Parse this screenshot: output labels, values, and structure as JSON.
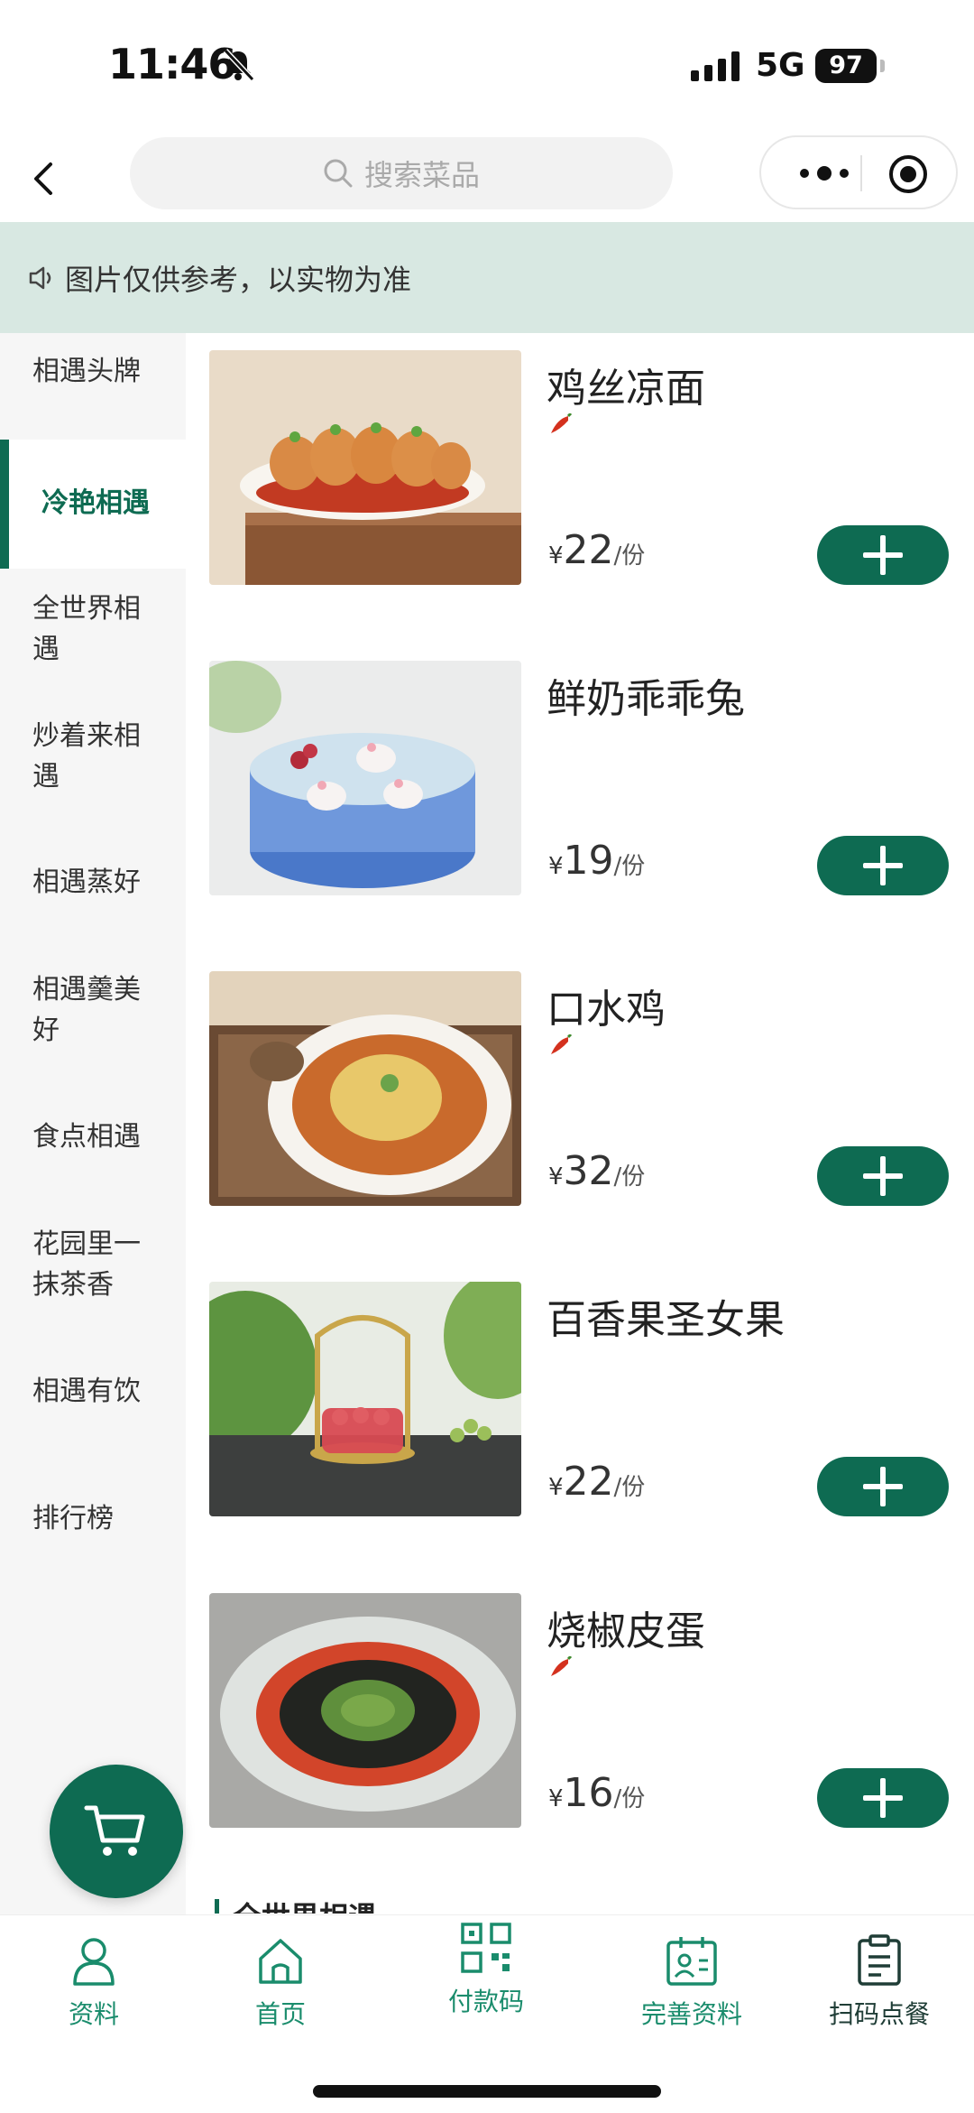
{
  "status_bar": {
    "time": "11:46",
    "network": "5G",
    "battery": "97"
  },
  "header": {
    "search_placeholder": "搜索菜品"
  },
  "notice": {
    "text": "图片仅供参考，以实物为准"
  },
  "sidebar": {
    "items": [
      {
        "label": "相遇头牌"
      },
      {
        "label": "冷艳相遇",
        "active": true
      },
      {
        "label": "全世界相遇"
      },
      {
        "label": "炒着来相遇"
      },
      {
        "label": "相遇蒸好"
      },
      {
        "label": "相遇羹美好"
      },
      {
        "label": "食点相遇"
      },
      {
        "label": "花园里一抹茶香"
      },
      {
        "label": "相遇有饮"
      },
      {
        "label": "排行榜"
      }
    ]
  },
  "dishes": [
    {
      "name": "鸡丝凉面",
      "currency": "¥",
      "price": "22",
      "unit": "/份",
      "spicy": true
    },
    {
      "name": "鲜奶乖乖兔",
      "currency": "¥",
      "price": "19",
      "unit": "/份",
      "spicy": false
    },
    {
      "name": "口水鸡",
      "currency": "¥",
      "price": "32",
      "unit": "/份",
      "spicy": true
    },
    {
      "name": "百香果圣女果",
      "currency": "¥",
      "price": "22",
      "unit": "/份",
      "spicy": false
    },
    {
      "name": "烧椒皮蛋",
      "currency": "¥",
      "price": "16",
      "unit": "/份",
      "spicy": true
    }
  ],
  "next_section": {
    "title": "全世界相遇"
  },
  "tabbar": {
    "items": [
      {
        "label": "资料",
        "icon": "person-icon"
      },
      {
        "label": "首页",
        "icon": "home-icon"
      },
      {
        "label": "付款码",
        "icon": "qr-code-icon"
      },
      {
        "label": "完善资料",
        "icon": "profile-card-icon"
      },
      {
        "label": "扫码点餐",
        "icon": "clipboard-icon"
      }
    ]
  },
  "colors": {
    "accent": "#0e6b52",
    "notice_bg": "#d8e8e2",
    "tab_label": "#1a8c6c"
  }
}
